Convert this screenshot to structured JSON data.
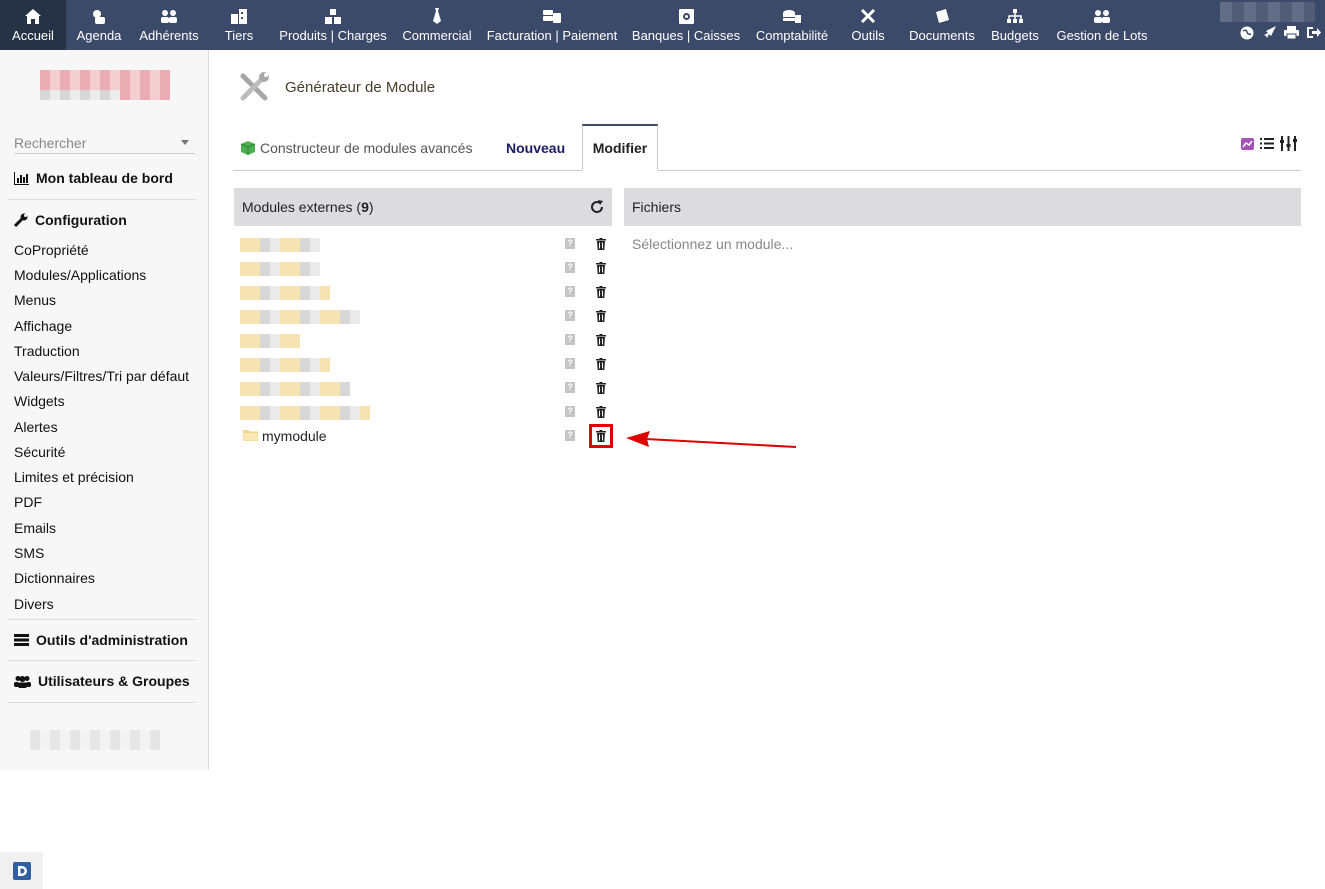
{
  "topnav": {
    "items": [
      {
        "label": "Accueil",
        "icon": "home-icon"
      },
      {
        "label": "Agenda",
        "icon": "agenda-icon"
      },
      {
        "label": "Adhérents",
        "icon": "members-icon"
      },
      {
        "label": "Tiers",
        "icon": "building-icon"
      },
      {
        "label": "Produits | Charges",
        "icon": "boxes-icon"
      },
      {
        "label": "Commercial",
        "icon": "tie-icon"
      },
      {
        "label": "Facturation | Paiement",
        "icon": "money-icon"
      },
      {
        "label": "Banques | Caisses",
        "icon": "safe-icon"
      },
      {
        "label": "Comptabilité",
        "icon": "coins-icon"
      },
      {
        "label": "Outils",
        "icon": "tools-icon"
      },
      {
        "label": "Documents",
        "icon": "documents-icon"
      },
      {
        "label": "Budgets",
        "icon": "sitemap-icon"
      },
      {
        "label": "Gestion de Lots",
        "icon": "users-icon"
      }
    ],
    "active": "Accueil"
  },
  "sidebar": {
    "search_placeholder": "Rechercher",
    "dashboard_label": "Mon tableau de bord",
    "config_label": "Configuration",
    "config_items": [
      "CoPropriété",
      "Modules/Applications",
      "Menus",
      "Affichage",
      "Traduction",
      "Valeurs/Filtres/Tri par défaut",
      "Widgets",
      "Alertes",
      "Sécurité",
      "Limites et précision",
      "PDF",
      "Emails",
      "SMS",
      "Dictionnaires",
      "Divers"
    ],
    "admin_tools_label": "Outils d'administration",
    "users_groups_label": "Utilisateurs & Groupes"
  },
  "page": {
    "title": "Générateur de Module",
    "tabs": {
      "builder": "Constructeur de modules avancés",
      "new": "Nouveau",
      "edit": "Modifier"
    },
    "active_tab": "Modifier"
  },
  "modules_panel": {
    "title": "Modules externes (",
    "count": "9",
    "title_end": ")",
    "visible_module": "mymodule"
  },
  "files_panel": {
    "title": "Fichiers",
    "empty_text": "Sélectionnez un module..."
  },
  "colors": {
    "topbar": "#3b4a69",
    "highlight": "#e00000",
    "tab_new_text": "#1a1a6b"
  }
}
